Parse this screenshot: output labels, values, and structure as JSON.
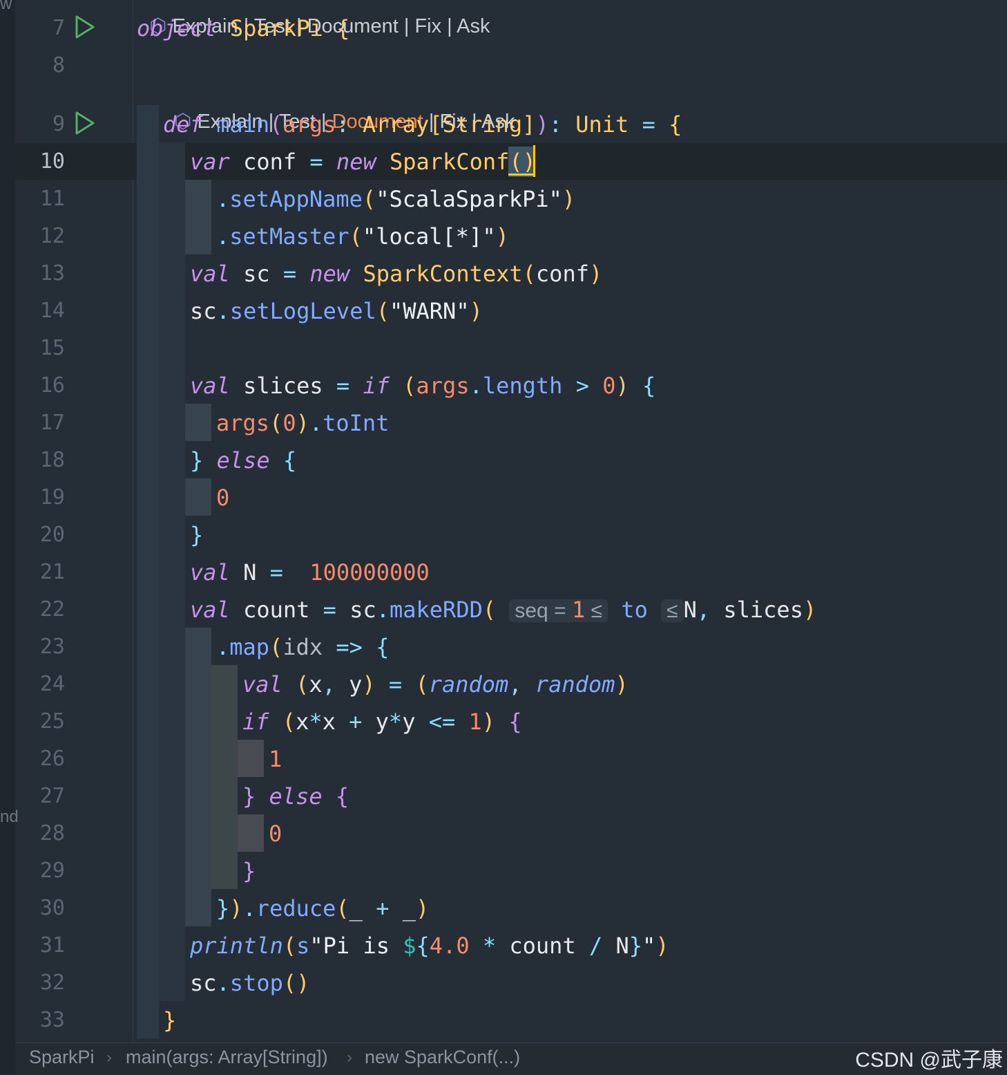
{
  "codelens": {
    "explain": "Explain",
    "test": "Test",
    "document": "Document",
    "fix": "Fix",
    "ask": "Ask",
    "sep": " | "
  },
  "side_labels": {
    "top": "w",
    "mid": "nd"
  },
  "lines": {
    "n7": "7",
    "n8": "8",
    "n9": "9",
    "n10": "10",
    "n11": "11",
    "n12": "12",
    "n13": "13",
    "n14": "14",
    "n15": "15",
    "n16": "16",
    "n17": "17",
    "n18": "18",
    "n19": "19",
    "n20": "20",
    "n21": "21",
    "n22": "22",
    "n23": "23",
    "n24": "24",
    "n25": "25",
    "n26": "26",
    "n27": "27",
    "n28": "28",
    "n29": "29",
    "n30": "30",
    "n31": "31",
    "n32": "32",
    "n33": "33"
  },
  "code": {
    "object": "object",
    "sparkpi": "SparkPi",
    "def": "def",
    "main": "main",
    "args": "args",
    "array": "Array",
    "string": "String",
    "unit": "Unit",
    "var": "var",
    "conf": "conf",
    "new": "new",
    "sparkconf": "SparkConf",
    "setAppName": "setAppName",
    "appname": "\"ScalaSparkPi\"",
    "setMaster": "setMaster",
    "master": "\"local[*]\"",
    "val": "val",
    "sc": "sc",
    "sparkcontext": "SparkContext",
    "setLogLevel": "setLogLevel",
    "warn": "\"WARN\"",
    "slices": "slices",
    "if": "if",
    "length": "length",
    "zero": "0",
    "toInt": "toInt",
    "else": "else",
    "N": "N",
    "nval": "100000000",
    "count": "count",
    "makeRDD": "makeRDD",
    "seq_hint": "seq =",
    "one": "1",
    "le": "≤",
    "to": "to",
    "map": "map",
    "idx": "idx",
    "x": "x",
    "y": "y",
    "random": "random",
    "reduce": "reduce",
    "println": "println",
    "s": "s",
    "pi_is": "\"Pi is ",
    "four": "4.0",
    "close_str": "\"",
    "stop": "stop"
  },
  "breadcrumb": [
    "SparkPi",
    "main(args: Array[String])",
    "new SparkConf(...)"
  ],
  "watermark": "CSDN @武子康",
  "colors": {
    "background": "#252d36",
    "keyword": "#c792ea",
    "type": "#ffcb6b",
    "function": "#82aaff",
    "number": "#f78c6c",
    "caret": "#ffcc00"
  }
}
